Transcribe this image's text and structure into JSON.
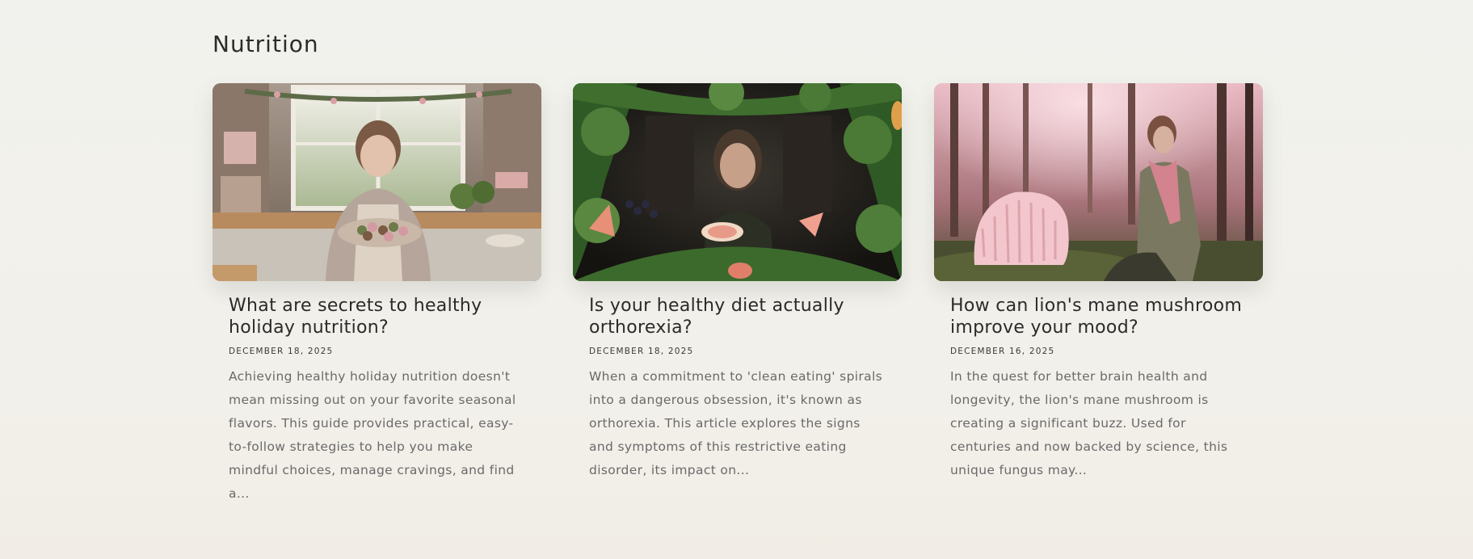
{
  "section": {
    "title": "Nutrition"
  },
  "cards": [
    {
      "title": "What are secrets to healthy holiday nutrition?",
      "date": "DECEMBER 18, 2025",
      "excerpt": "Achieving healthy holiday nutrition doesn't mean missing out on your favorite seasonal flavors. This guide provides practical, easy-to-follow strategies to help you make mindful choices, manage cravings, and find a..."
    },
    {
      "title": "Is your healthy diet actually orthorexia?",
      "date": "DECEMBER 18, 2025",
      "excerpt": "When a commitment to 'clean eating' spirals into a dangerous obsession, it's known as orthorexia. This article explores the signs and symptoms of this restrictive eating disorder, its impact on..."
    },
    {
      "title": "How can lion's mane mushroom improve your mood?",
      "date": "DECEMBER 16, 2025",
      "excerpt": "In the quest for better brain health and longevity, the lion's mane mushroom is creating a significant buzz. Used for centuries and now backed by science, this unique fungus may..."
    }
  ],
  "colors": {
    "background": "#f1f0eb",
    "text": "#2b2b2b",
    "excerpt": "#6a6a6a"
  }
}
